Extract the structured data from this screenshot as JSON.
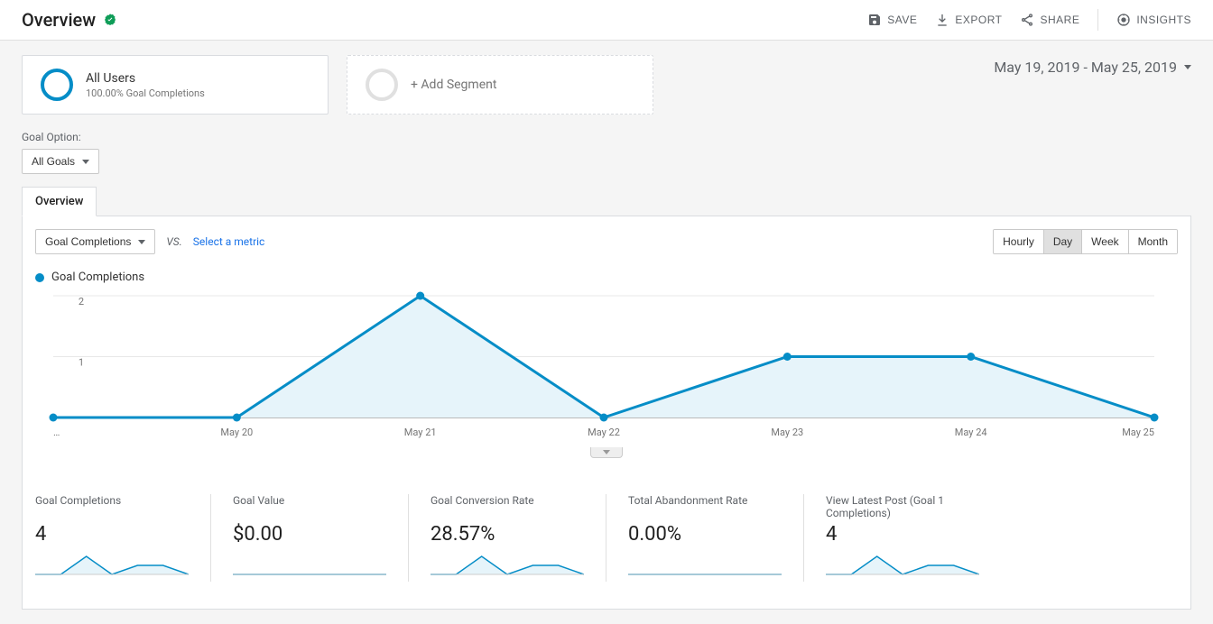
{
  "header": {
    "title": "Overview",
    "actions": {
      "save": "SAVE",
      "export": "EXPORT",
      "share": "SHARE",
      "insights": "INSIGHTS"
    }
  },
  "segments": {
    "active": {
      "title": "All Users",
      "sub": "100.00% Goal Completions"
    },
    "add": "+ Add Segment"
  },
  "date_range": "May 19, 2019 - May 25, 2019",
  "goal_option": {
    "label": "Goal Option:",
    "selected": "All Goals"
  },
  "tab": "Overview",
  "metric_selector": {
    "primary": "Goal Completions",
    "vs": "VS.",
    "select_link": "Select a metric"
  },
  "granularity": {
    "options": [
      "Hourly",
      "Day",
      "Week",
      "Month"
    ],
    "active": "Day"
  },
  "chart_legend": "Goal Completions",
  "chart_data": {
    "type": "line",
    "categories": [
      "…",
      "May 20",
      "May 21",
      "May 22",
      "May 23",
      "May 24",
      "May 25"
    ],
    "values": [
      0,
      0,
      2,
      0,
      1,
      1,
      0
    ],
    "ylabel": "",
    "ylim": [
      0,
      2
    ],
    "yticks": [
      1,
      2
    ],
    "series_name": "Goal Completions"
  },
  "metrics": [
    {
      "label": "Goal Completions",
      "value": "4",
      "spark": [
        0,
        0,
        2,
        0,
        1,
        1,
        0
      ]
    },
    {
      "label": "Goal Value",
      "value": "$0.00",
      "spark": [
        0,
        0,
        0,
        0,
        0,
        0,
        0
      ]
    },
    {
      "label": "Goal Conversion Rate",
      "value": "28.57%",
      "spark": [
        0,
        0,
        2,
        0,
        1,
        1,
        0
      ]
    },
    {
      "label": "Total Abandonment Rate",
      "value": "0.00%",
      "spark": [
        0,
        0,
        0,
        0,
        0,
        0,
        0
      ]
    },
    {
      "label": "View Latest Post (Goal 1 Completions)",
      "value": "4",
      "spark": [
        0,
        0,
        2,
        0,
        1,
        1,
        0
      ]
    }
  ]
}
